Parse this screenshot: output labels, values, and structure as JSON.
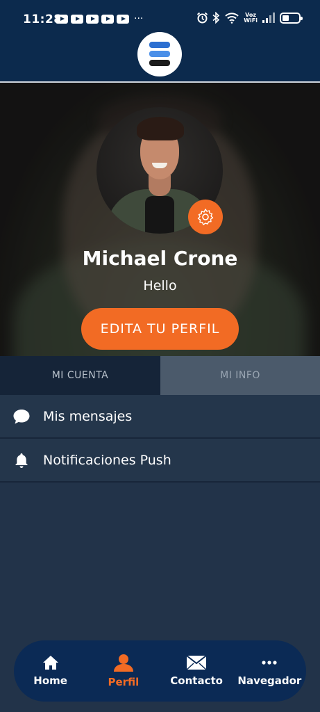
{
  "status_bar": {
    "time": "11:28",
    "voz_top": "Voz",
    "voz_bottom": "WiFi",
    "battery_level": 0.35
  },
  "header": {
    "logo_icon": "brand-logo-stacked-bars"
  },
  "profile": {
    "name": "Michael Crone",
    "bio": "Hello",
    "edit_button": "EDITA TU PERFIL",
    "settings_icon": "gear-icon"
  },
  "tabs": [
    {
      "label": "MI CUENTA",
      "active": true
    },
    {
      "label": "MI INFO",
      "active": false
    }
  ],
  "menu": [
    {
      "label": "Mis mensajes",
      "icon": "chat-bubble-icon"
    },
    {
      "label": "Notificaciones Push",
      "icon": "bell-icon"
    }
  ],
  "bottom_nav": [
    {
      "label": "Home",
      "icon": "home-icon",
      "active": false
    },
    {
      "label": "Perfil",
      "icon": "user-icon",
      "active": true
    },
    {
      "label": "Contacto",
      "icon": "envelope-icon",
      "active": false
    },
    {
      "label": "Navegador",
      "icon": "more-dots-icon",
      "active": false
    }
  ],
  "colors": {
    "accent": "#f26b24",
    "header_bg": "#0c2a4d",
    "page_bg": "#223349",
    "nav_bg": "#0b2a55"
  }
}
